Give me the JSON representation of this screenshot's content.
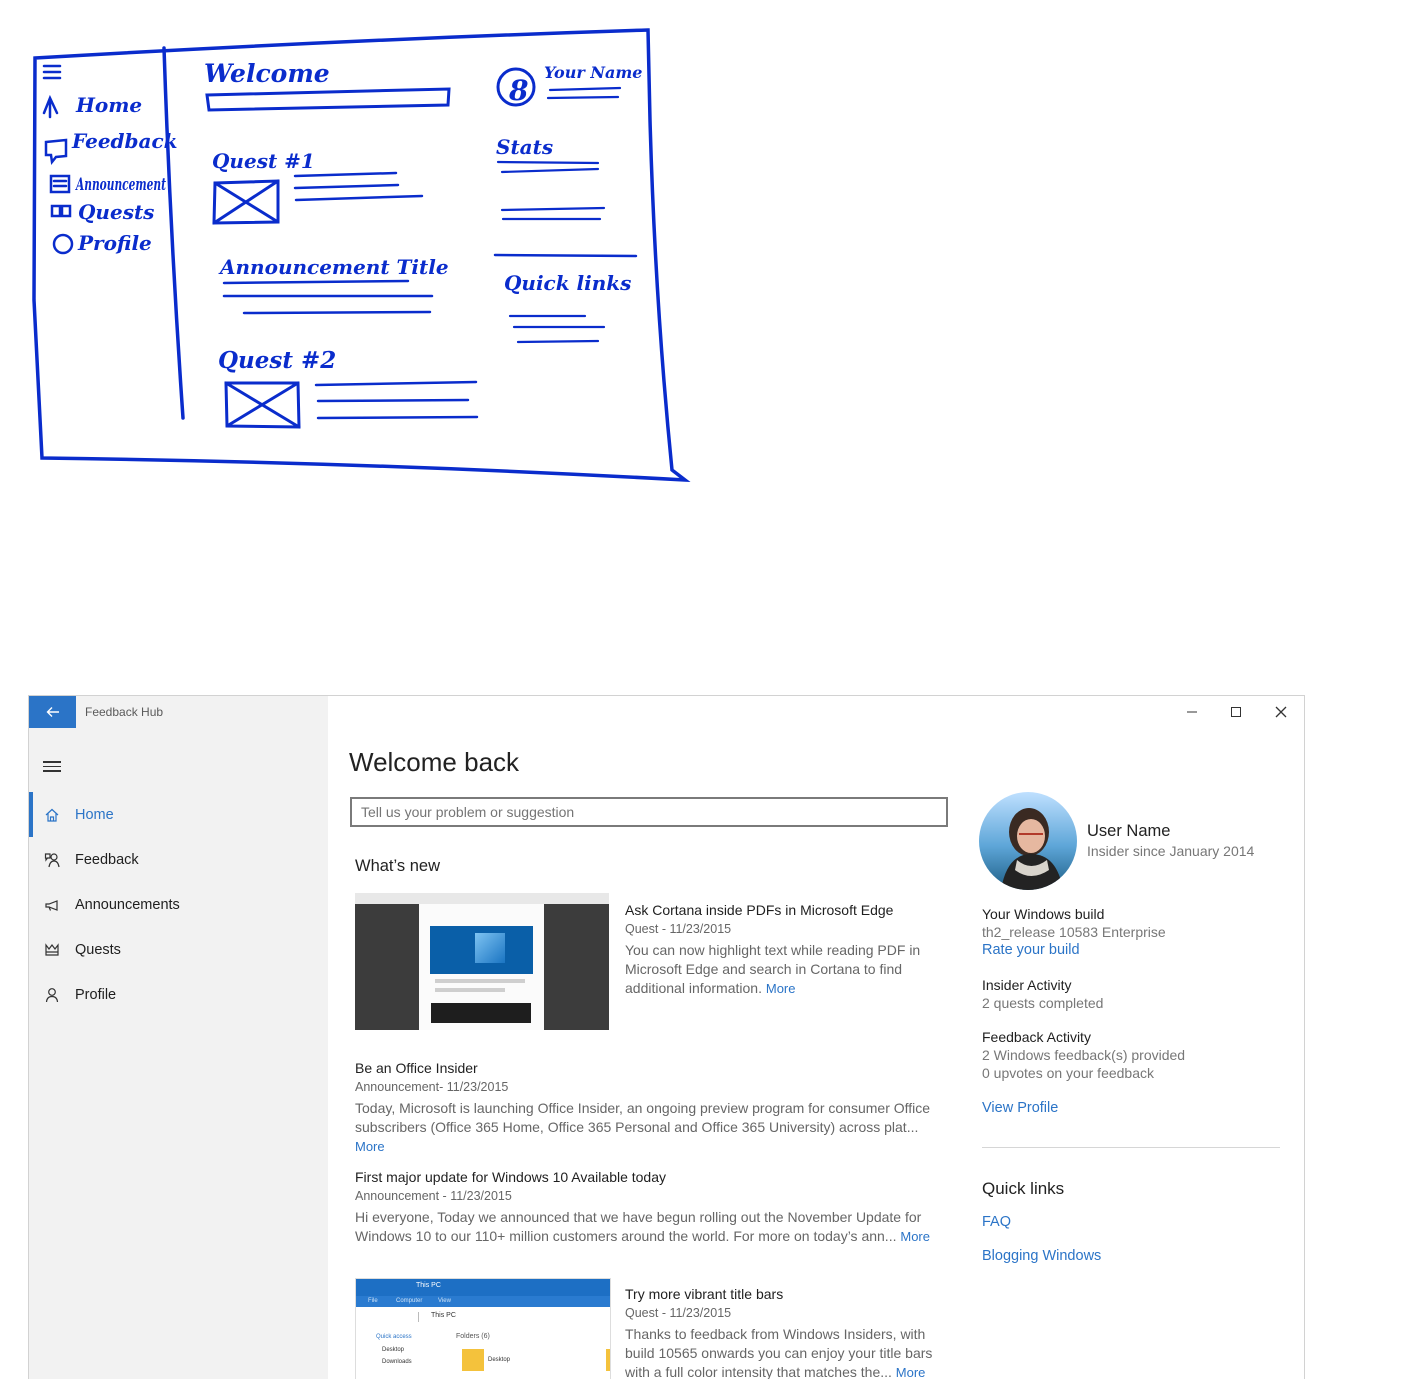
{
  "sketch": {
    "nav": [
      "Home",
      "Feedback",
      "Announcement",
      "Quests",
      "Profile"
    ],
    "welcome": "Welcome",
    "quest1": "Quest #1",
    "announcement": "Announcement Title",
    "quest2": "Quest #2",
    "your_name": "Your Name",
    "stats": "Stats",
    "quick_links": "Quick links"
  },
  "app": {
    "title": "Feedback Hub",
    "nav": [
      {
        "label": "Home",
        "icon": "home-icon",
        "active": true
      },
      {
        "label": "Feedback",
        "icon": "feedback-icon"
      },
      {
        "label": "Announcements",
        "icon": "megaphone-icon"
      },
      {
        "label": "Quests",
        "icon": "quests-icon"
      },
      {
        "label": "Profile",
        "icon": "person-icon"
      }
    ],
    "heading": "Welcome back",
    "search_placeholder": "Tell us your problem or suggestion",
    "whats_new": "What’s new",
    "feed": [
      {
        "title": "Ask Cortana inside PDFs in Microsoft Edge",
        "meta": "Quest - 11/23/2015",
        "body": "You can now highlight text while reading PDF in Microsoft Edge and search in Cortana to find additional information.",
        "more": "More"
      },
      {
        "title": "Be an Office Insider",
        "meta": "Announcement- 11/23/2015",
        "body": "Today, Microsoft is launching Office Insider, an ongoing preview program for consumer Office subscribers (Office 365 Home, Office 365 Personal and Office 365 University) across plat...",
        "more": "More"
      },
      {
        "title": "First major update for Windows 10 Available today",
        "meta": "Announcement - 11/23/2015",
        "body": "Hi everyone, Today we announced that we have begun rolling out the November Update for Windows 10 to our 110+ million customers around the world. For more on today’s ann...",
        "more": "More"
      },
      {
        "title": "Try more vibrant title bars",
        "meta": "Quest - 11/23/2015",
        "body": "Thanks to feedback from Windows Insiders, with build 10565 onwards you can enjoy your title bars with a full color intensity that matches the...",
        "more": "More"
      }
    ],
    "explorer_thumb": {
      "title": "This PC",
      "tabs": [
        "File",
        "Computer",
        "View"
      ],
      "path": "This PC",
      "quick_access": "Quick access",
      "items": [
        "Desktop",
        "Downloads"
      ],
      "folders": "Folders (6)",
      "folder_name": "Desktop"
    },
    "profile": {
      "name": "User Name",
      "since": "Insider since January 2014",
      "build_label": "Your Windows build",
      "build_value": "th2_release 10583 Enterprise",
      "rate_link": "Rate your build",
      "insider_label": "Insider Activity",
      "insider_value": "2 quests completed",
      "feedback_label": "Feedback Activity",
      "feedback_value1": "2 Windows feedback(s) provided",
      "feedback_value2": "0 upvotes on your feedback",
      "view_profile": "View Profile"
    },
    "quick_links": {
      "title": "Quick links",
      "items": [
        "FAQ",
        "Blogging Windows"
      ]
    },
    "colors": {
      "accent": "#2b74c7",
      "sidebar": "#f2f2f2",
      "sketch_ink": "#0a2ccc"
    }
  }
}
